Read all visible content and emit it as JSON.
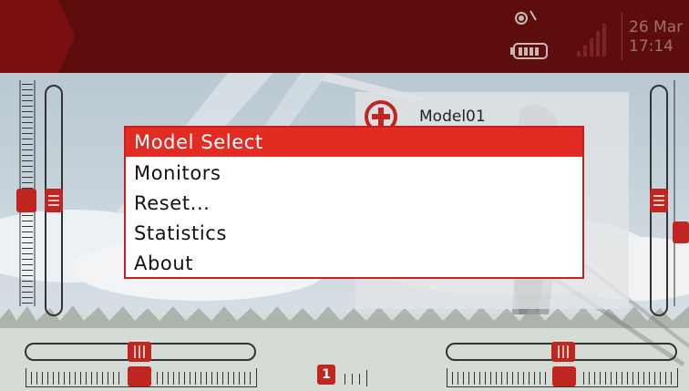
{
  "colors": {
    "topbar": "#5e0d0d",
    "accent": "#e32b23",
    "popup_border": "#c81e1e",
    "slider": "#c0251f"
  },
  "header": {
    "menu_icon": "radio-menu-tab",
    "status_icons": [
      "sound-icon",
      "battery-icon",
      "signal-bars-icon"
    ],
    "date": "26 Mar",
    "time": "17:14"
  },
  "model": {
    "icon": "add-circle-icon",
    "name": "Model01"
  },
  "popup_menu": {
    "items": [
      {
        "label": "Model Select",
        "selected": true
      },
      {
        "label": "Monitors",
        "selected": false
      },
      {
        "label": "Reset...",
        "selected": false
      },
      {
        "label": "Statistics",
        "selected": false
      },
      {
        "label": "About",
        "selected": false
      }
    ]
  },
  "trims": {
    "flight_mode_label": "1"
  }
}
